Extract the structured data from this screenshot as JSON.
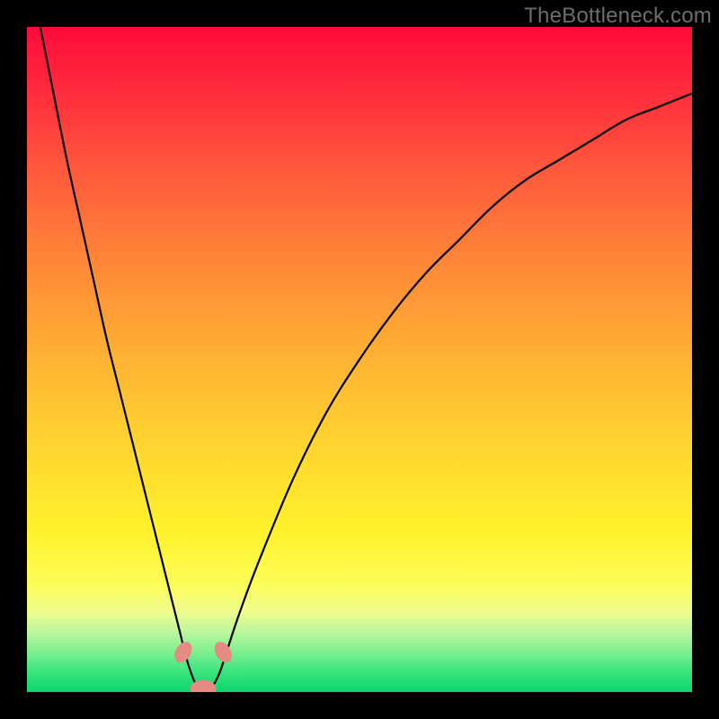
{
  "watermark": "TheBottleneck.com",
  "chart_data": {
    "type": "line",
    "title": "",
    "xlabel": "",
    "ylabel": "",
    "xlim": [
      0,
      100
    ],
    "ylim": [
      0,
      100
    ],
    "series": [
      {
        "name": "bottleneck-curve",
        "x": [
          2,
          4,
          6,
          8,
          10,
          12,
          14,
          16,
          18,
          20,
          21,
          22,
          23,
          24,
          25,
          26,
          27,
          28,
          29,
          30,
          32,
          35,
          40,
          45,
          50,
          55,
          60,
          65,
          70,
          75,
          80,
          85,
          90,
          95,
          100
        ],
        "values": [
          100,
          90,
          80,
          71,
          62,
          53,
          45,
          37,
          29,
          21,
          17,
          13,
          9,
          5,
          2,
          0,
          0,
          1,
          3,
          6,
          12,
          20,
          32,
          42,
          50,
          57,
          63,
          68,
          73,
          77,
          80,
          83,
          86,
          88,
          90
        ]
      }
    ],
    "markers": [
      {
        "name": "left-blob",
        "x": 23.5,
        "y": 6,
        "size": 3
      },
      {
        "name": "right-blob",
        "x": 29.5,
        "y": 6,
        "size": 3
      },
      {
        "name": "bottom-blob",
        "x": 26.5,
        "y": 0.5,
        "size": 3.5
      }
    ],
    "colors": {
      "curve": "#000000",
      "marker": "#e58b82"
    }
  }
}
